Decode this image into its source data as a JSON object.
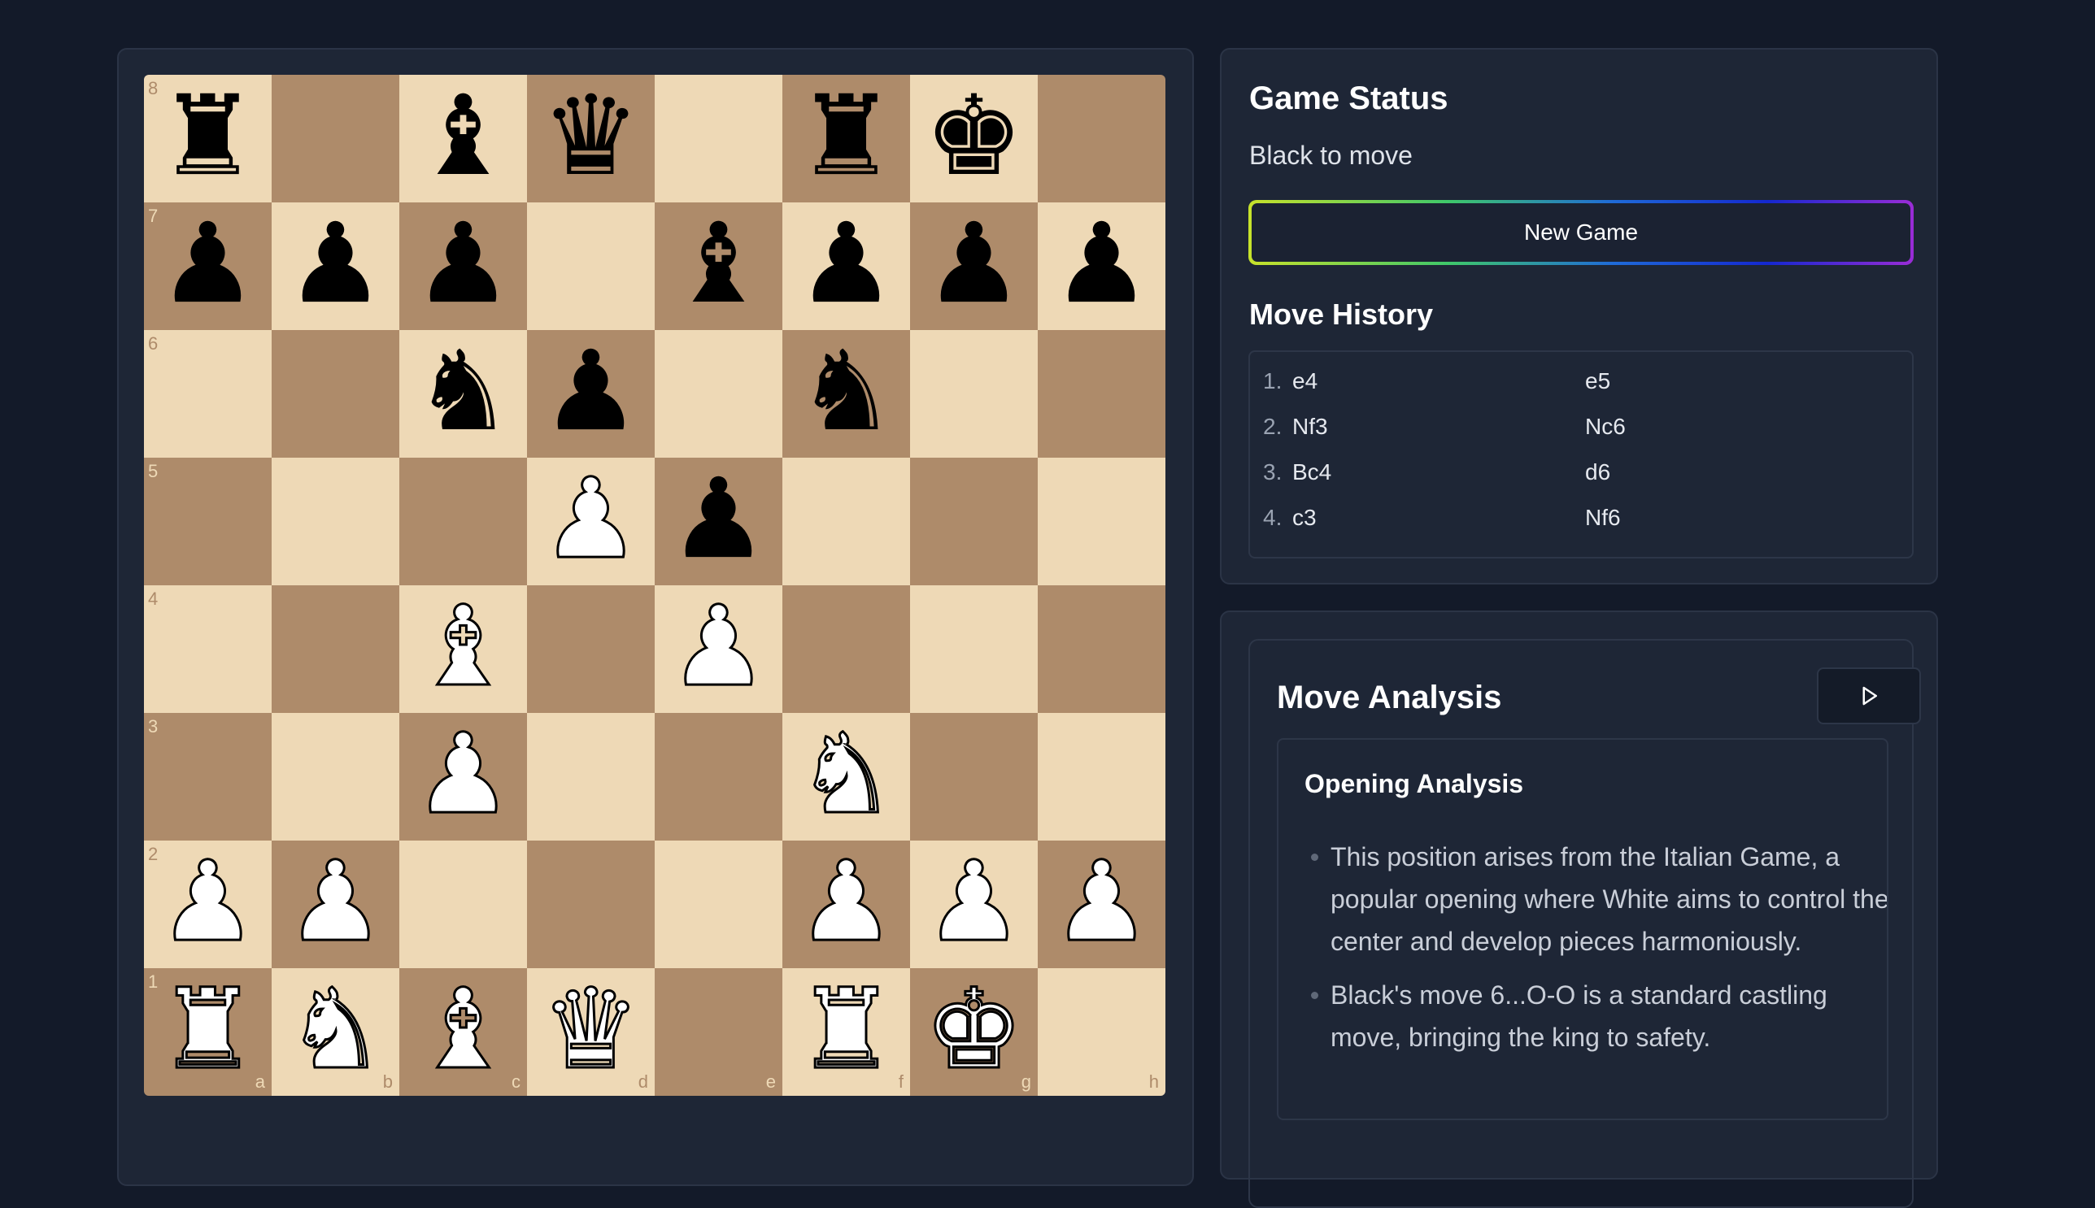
{
  "board": {
    "files": [
      "a",
      "b",
      "c",
      "d",
      "e",
      "f",
      "g",
      "h"
    ],
    "ranks": [
      "8",
      "7",
      "6",
      "5",
      "4",
      "3",
      "2",
      "1"
    ],
    "position": [
      [
        "bR",
        "",
        "bB",
        "bQ",
        "",
        "bR",
        "bK",
        ""
      ],
      [
        "bP",
        "bP",
        "bP",
        "",
        "bB",
        "bP",
        "bP",
        "bP"
      ],
      [
        "",
        "",
        "bN",
        "bP",
        "",
        "bN",
        "",
        ""
      ],
      [
        "",
        "",
        "",
        "wP",
        "bP",
        "",
        "",
        ""
      ],
      [
        "",
        "",
        "wB",
        "",
        "wP",
        "",
        "",
        ""
      ],
      [
        "",
        "",
        "wP",
        "",
        "",
        "wN",
        "",
        ""
      ],
      [
        "wP",
        "wP",
        "",
        "",
        "",
        "wP",
        "wP",
        "wP"
      ],
      [
        "wR",
        "wN",
        "wB",
        "wQ",
        "",
        "wR",
        "wK",
        ""
      ]
    ],
    "colors": {
      "light": "#eed9b6",
      "dark": "#ae8b6a"
    }
  },
  "status": {
    "title": "Game Status",
    "text": "Black to move",
    "new_game_label": "New Game"
  },
  "history": {
    "title": "Move History",
    "moves": [
      {
        "num": "1.",
        "white": "e4",
        "black": "e5"
      },
      {
        "num": "2.",
        "white": "Nf3",
        "black": "Nc6"
      },
      {
        "num": "3.",
        "white": "Bc4",
        "black": "d6"
      },
      {
        "num": "4.",
        "white": "c3",
        "black": "Nf6"
      }
    ]
  },
  "analysis": {
    "title": "Move Analysis",
    "play_icon": "play-icon",
    "section_title": "Opening Analysis",
    "points": [
      "This position arises from the Italian Game, a popular opening where White aims to control the center and develop pieces harmoniously.",
      "Black's move 6...O-O is a standard castling move, bringing the king to safety."
    ]
  }
}
